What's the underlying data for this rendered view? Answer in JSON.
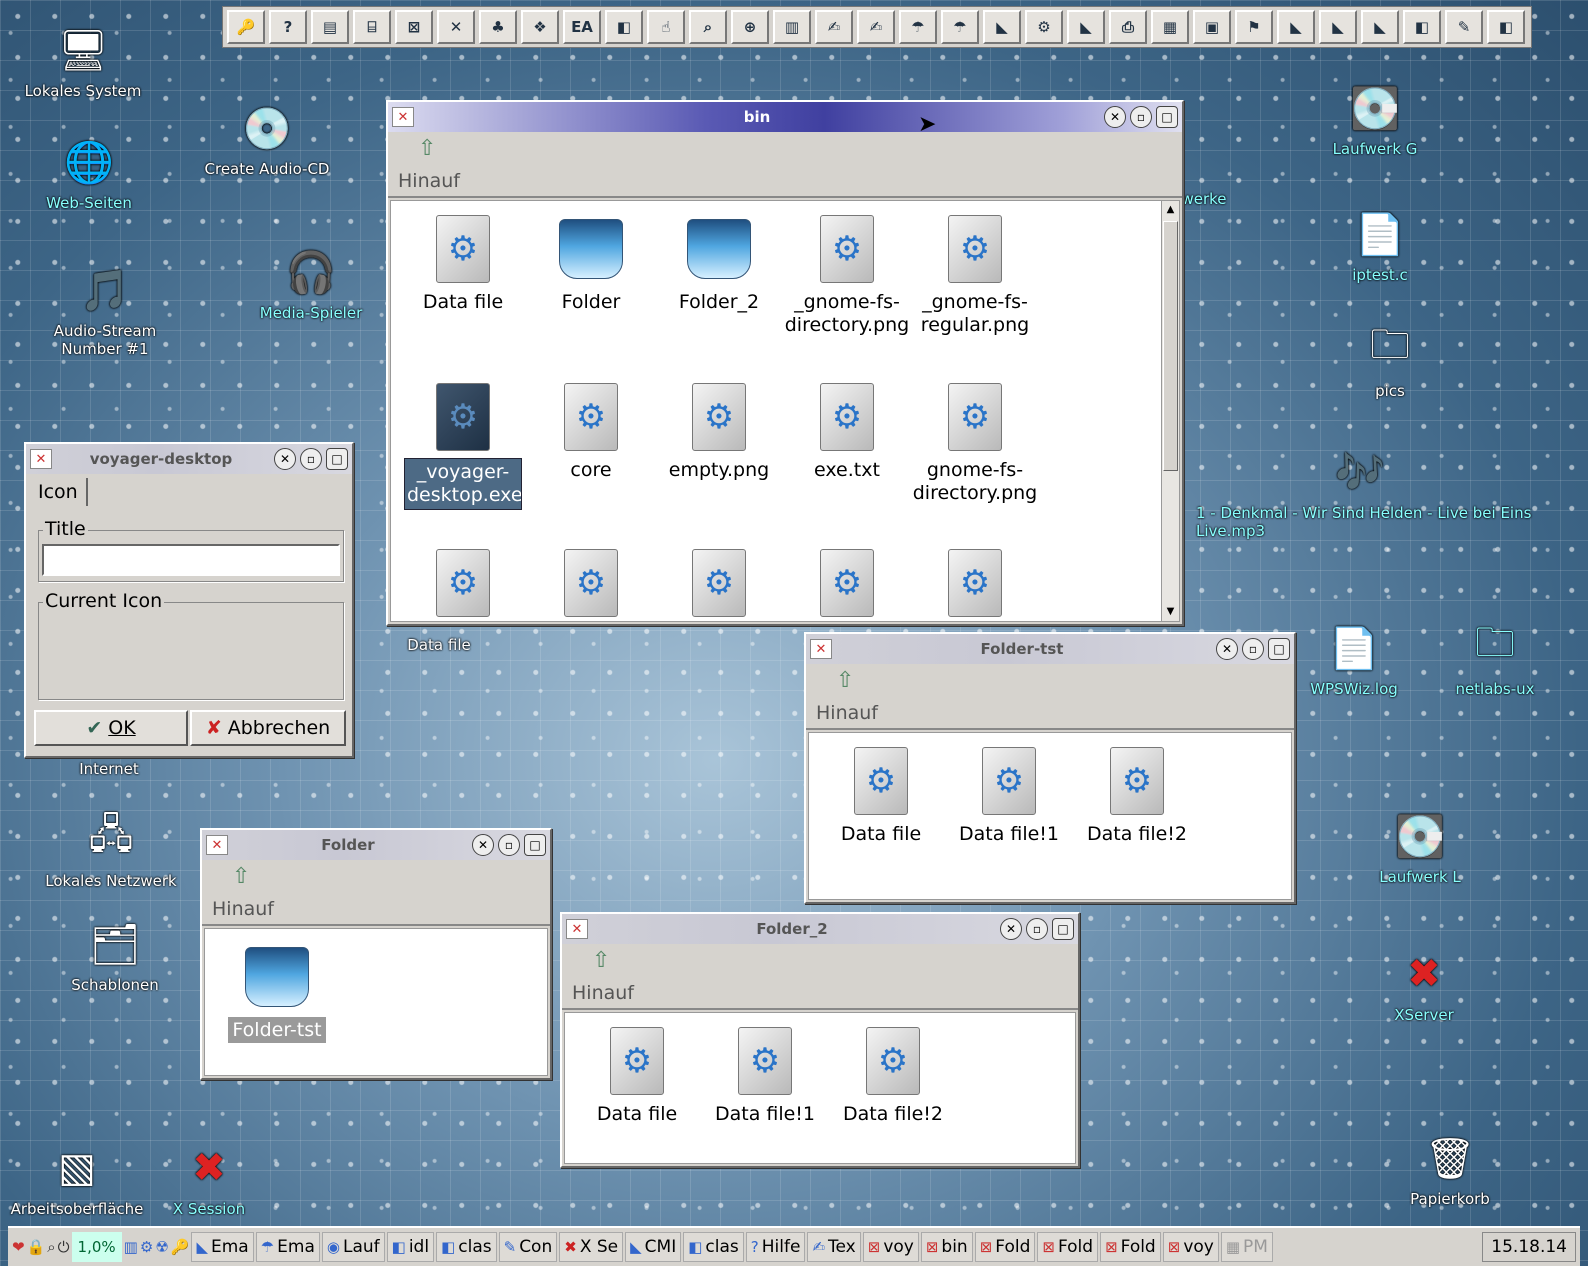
{
  "toolbar": {
    "ea_label": "EA"
  },
  "desktop": {
    "left_icons": [
      "Lokales System",
      "Web-Seiten",
      "Create Audio-CD",
      "Audio-Stream Number #1",
      "Media-Spieler",
      "Internet",
      "Lokales Netzwerk",
      "Schablonen",
      "Arbeitsoberfläche",
      "X Session",
      "Data file"
    ],
    "right_icons": [
      "Laufwerk G",
      "werke",
      "iptest.c",
      "pics",
      "1 - Denkmal - Wir Sind Helden - Live bei Eins Live.mp3",
      "WPSWiz.log",
      "netlabs-ux",
      "Laufwerk L",
      "XServer",
      "Papierkorb"
    ]
  },
  "bin_window": {
    "title": "bin",
    "up_label": "Hinauf",
    "items": [
      "Data file",
      "Folder",
      "Folder_2",
      "_gnome-fs-directory.png",
      "_gnome-fs-regular.png",
      "_voyager-desktop.exe",
      "core",
      "empty.png",
      "exe.txt",
      "gnome-fs-directory.png"
    ]
  },
  "voyager_dialog": {
    "title": "voyager-desktop",
    "tab": "Icon",
    "title_group": "Title",
    "title_value": "",
    "icon_group": "Current Icon",
    "ok": "OK",
    "cancel": "Abbrechen"
  },
  "folder_tst_window": {
    "title": "Folder-tst",
    "up_label": "Hinauf",
    "items": [
      "Data file",
      "Data file!1",
      "Data file!2"
    ]
  },
  "folder_window": {
    "title": "Folder",
    "up_label": "Hinauf",
    "items": [
      "Folder-tst"
    ]
  },
  "folder2_window": {
    "title": "Folder_2",
    "up_label": "Hinauf",
    "items": [
      "Data file",
      "Data file!1",
      "Data file!2"
    ]
  },
  "taskbar": {
    "cpu": "1,0%",
    "tasks": [
      "Ema",
      "Ema",
      "Lauf",
      "idl",
      "clas",
      "Con",
      "X Se",
      "CMI",
      "clas",
      "Hilfe",
      "Tex",
      "voy",
      "bin",
      "Fold",
      "Fold",
      "Fold",
      "voy",
      "PM"
    ],
    "clock": "15.18.14"
  }
}
